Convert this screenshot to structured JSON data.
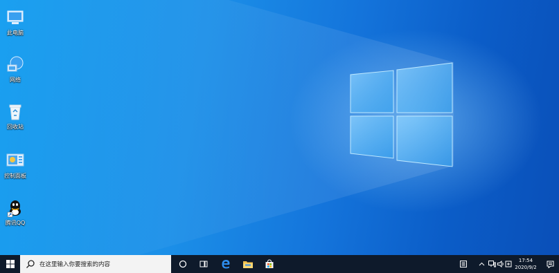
{
  "desktop_icons": [
    {
      "label": "此电脑",
      "icon": "this-pc-icon"
    },
    {
      "label": "网络",
      "icon": "network-icon"
    },
    {
      "label": "回收站",
      "icon": "recycle-bin-icon"
    },
    {
      "label": "控制面板",
      "icon": "control-panel-icon"
    },
    {
      "label": "腾讯QQ",
      "icon": "qq-icon"
    }
  ],
  "taskbar": {
    "search_placeholder": "在这里输入你要搜索的内容",
    "pinned": [
      "cortana-icon",
      "task-view-icon",
      "edge-icon",
      "file-explorer-icon",
      "microsoft-store-icon"
    ],
    "tray": {
      "time": "17:54",
      "date": "2020/9/2"
    }
  },
  "colors": {
    "taskbar": "#0e1a2b",
    "desktop": "#1a8fe8"
  }
}
